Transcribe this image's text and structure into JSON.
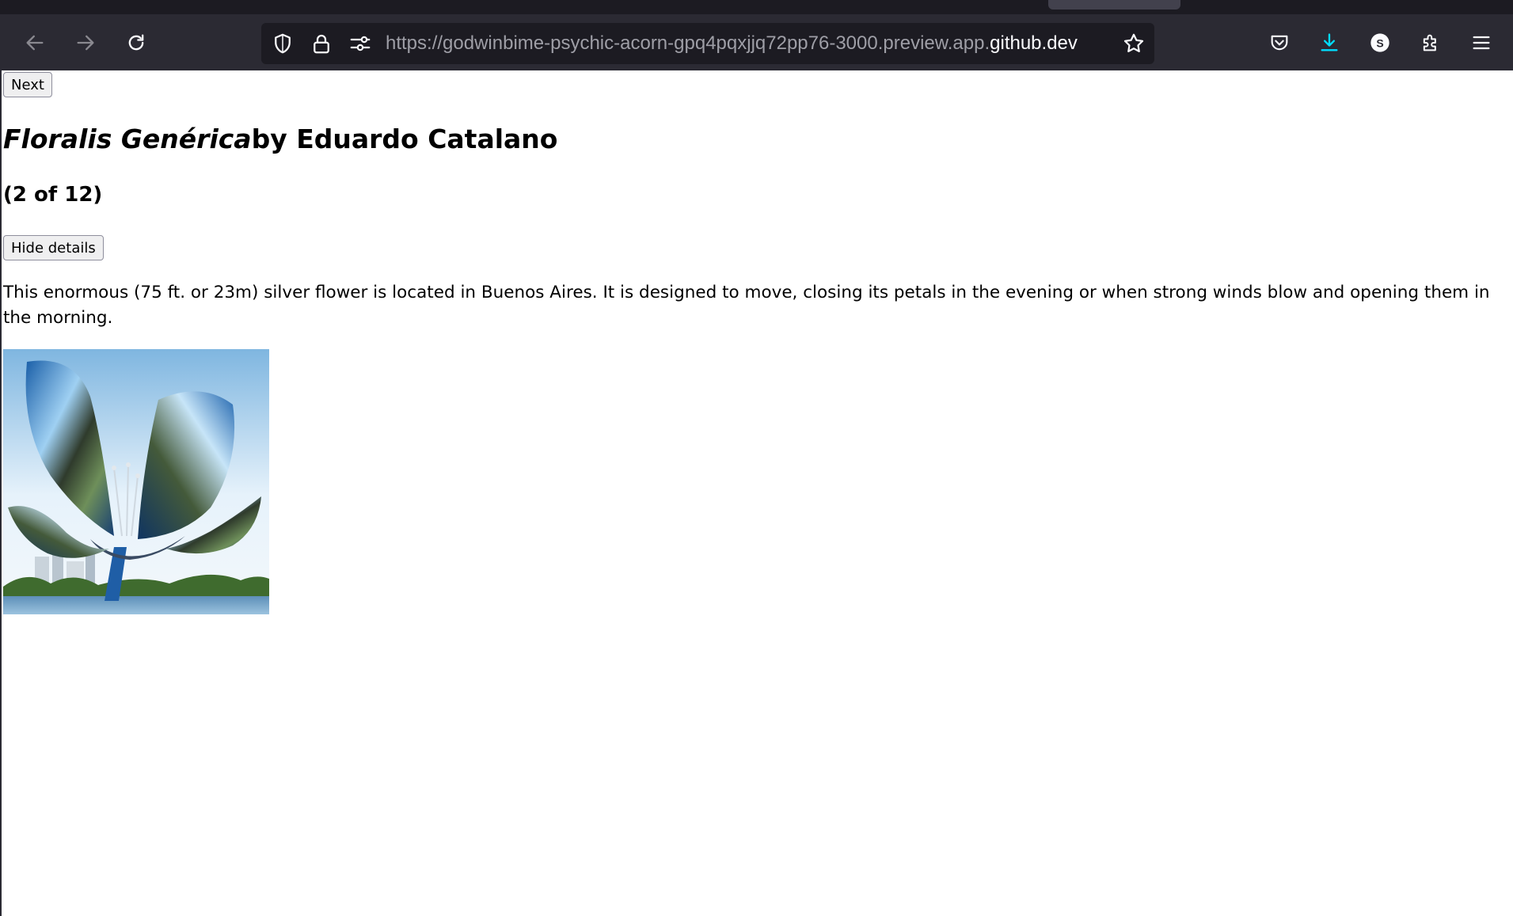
{
  "browser": {
    "url_prefix": "https://godwinbime-psychic-acorn-gpq4pqxjjq72pp76-3000.preview.app.",
    "url_domain": "github.dev",
    "profile_initial": "S",
    "icons": {
      "back": "arrow-left-icon",
      "forward": "arrow-right-icon",
      "reload": "reload-icon",
      "tracking_protection": "shield-icon",
      "connection": "lock-icon",
      "permissions": "sliders-icon",
      "bookmark": "star-icon",
      "pocket": "pocket-icon",
      "downloads": "download-icon",
      "extensions": "puzzle-icon",
      "menu": "hamburger-menu-icon"
    },
    "accent_colors": {
      "toolbar": "#2b2a33",
      "urlbar": "#1c1b22",
      "download": "#00ddff"
    }
  },
  "page": {
    "next_label": "Next",
    "title_work": "Floralis Genérica",
    "title_by": "by Eduardo Catalano",
    "counter": "(2 of 12)",
    "toggle_details_label": "Hide details",
    "description": "This enormous (75 ft. or 23m) silver flower is located in Buenos Aires. It is designed to move, closing its petals in the evening or when strong winds blow and opening them in the morning.",
    "image_alt": "Floralis Genérica"
  }
}
